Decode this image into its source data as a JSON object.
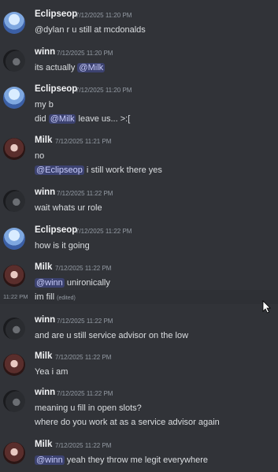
{
  "messages": [
    {
      "author": "Eclipseop",
      "timestamp": "7/12/2025 11:20 PM",
      "avatar": "eclipseop-avatar",
      "lines": [
        [
          {
            "t": "@dylan r u still at mcdonalds"
          }
        ]
      ]
    },
    {
      "author": "winn",
      "timestamp": "7/12/2025 11:20 PM",
      "avatar": "winn-avatar",
      "lines": [
        [
          {
            "t": "its actually "
          },
          {
            "t": "@Milk",
            "mention": true
          }
        ]
      ]
    },
    {
      "author": "Eclipseop",
      "timestamp": "7/12/2025 11:20 PM",
      "avatar": "eclipseop-avatar",
      "lines": [
        [
          {
            "t": "my b"
          }
        ],
        [
          {
            "t": "did "
          },
          {
            "t": "@Milk",
            "mention": true
          },
          {
            "t": " leave us... >:["
          }
        ]
      ]
    },
    {
      "author": "Milk",
      "timestamp": "7/12/2025 11:21 PM",
      "avatar": "milk-avatar",
      "lines": [
        [
          {
            "t": "no"
          }
        ],
        [
          {
            "t": "@Eclipseop",
            "mention": true
          },
          {
            "t": " i still work there yes"
          }
        ]
      ]
    },
    {
      "author": "winn",
      "timestamp": "7/12/2025 11:22 PM",
      "avatar": "winn-avatar",
      "lines": [
        [
          {
            "t": "wait whats ur role"
          }
        ]
      ]
    },
    {
      "author": "Eclipseop",
      "timestamp": "7/12/2025 11:22 PM",
      "avatar": "eclipseop-avatar",
      "lines": [
        [
          {
            "t": "how is it going"
          }
        ]
      ]
    },
    {
      "author": "Milk",
      "timestamp": "7/12/2025 11:22 PM",
      "avatar": "milk-avatar",
      "lines": [
        [
          {
            "t": "@winn",
            "mention": true
          },
          {
            "t": " unironically"
          }
        ]
      ]
    },
    {
      "author": "winn",
      "timestamp": "7/12/2025 11:22 PM",
      "avatar": "winn-avatar",
      "lines": [
        [
          {
            "t": "and are u still service advisor on the low"
          }
        ]
      ]
    },
    {
      "author": "Milk",
      "timestamp": "7/12/2025 11:22 PM",
      "avatar": "milk-avatar",
      "lines": [
        [
          {
            "t": "Yea i am"
          }
        ]
      ]
    },
    {
      "author": "winn",
      "timestamp": "7/12/2025 11:22 PM",
      "avatar": "winn-avatar",
      "lines": [
        [
          {
            "t": "meaning u fill in open slots?"
          }
        ],
        [
          {
            "t": "where do you work at as a service advisor again"
          }
        ]
      ]
    },
    {
      "author": "Milk",
      "timestamp": "7/12/2025 11:22 PM",
      "avatar": "milk-avatar",
      "lines": [
        [
          {
            "t": "@winn",
            "mention": true
          },
          {
            "t": " yeah they throw me legit everywhere"
          }
        ]
      ]
    }
  ],
  "continuation": {
    "side_time": "11:22 PM",
    "text": "im fill",
    "edited": "(edited)"
  },
  "colors": {
    "background": "#313338",
    "mention_bg": "#3c4270",
    "mention_fg": "#c9cdfb",
    "timestamp": "#949ba4"
  }
}
